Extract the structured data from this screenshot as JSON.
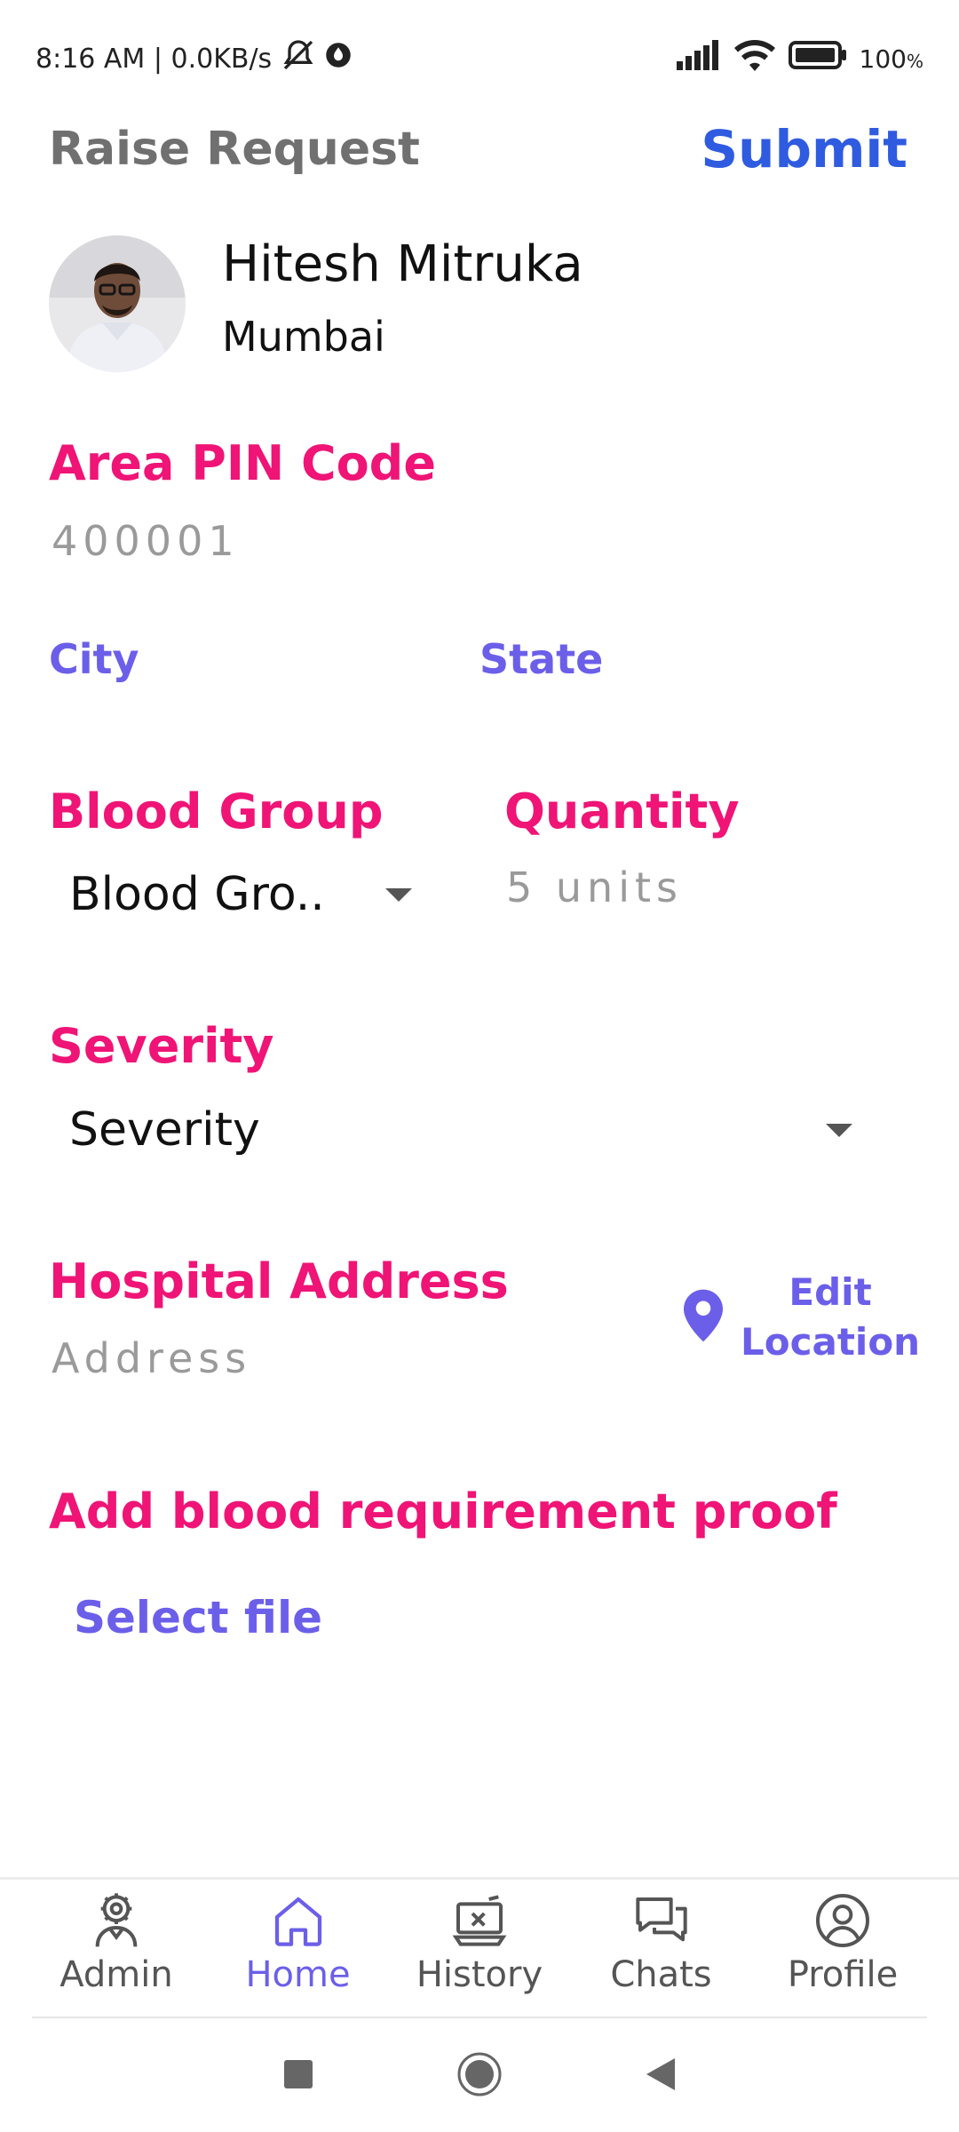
{
  "status_bar": {
    "time_speed": "8:16 AM | 0.0KB/s",
    "battery": "100",
    "battery_unit": "%"
  },
  "header": {
    "title": "Raise Request",
    "submit_label": "Submit"
  },
  "user": {
    "name": "Hitesh Mitruka",
    "city": "Mumbai"
  },
  "form": {
    "pin": {
      "label": "Area PIN Code",
      "value": "400001"
    },
    "city_label": "City",
    "state_label": "State",
    "blood_group": {
      "label": "Blood Group",
      "selected": "Blood Gro.."
    },
    "quantity": {
      "label": "Quantity",
      "placeholder": "5 units"
    },
    "severity": {
      "label": "Severity",
      "selected": "Severity"
    },
    "hospital": {
      "label": "Hospital Address",
      "placeholder": "Address",
      "edit_line1": "Edit",
      "edit_line2": "Location"
    },
    "proof": {
      "label": "Add blood requirement proof",
      "select_file": "Select file"
    }
  },
  "bottom_nav": {
    "items": [
      {
        "label": "Admin",
        "icon": "admin-gear-person-icon"
      },
      {
        "label": "Home",
        "icon": "home-icon",
        "active": true
      },
      {
        "label": "History",
        "icon": "history-icon"
      },
      {
        "label": "Chats",
        "icon": "chats-icon"
      },
      {
        "label": "Profile",
        "icon": "profile-icon"
      }
    ]
  },
  "colors": {
    "label_pink": "#ef1476",
    "accent_purple": "#6b5fe9",
    "submit_blue": "#2f5be0"
  }
}
